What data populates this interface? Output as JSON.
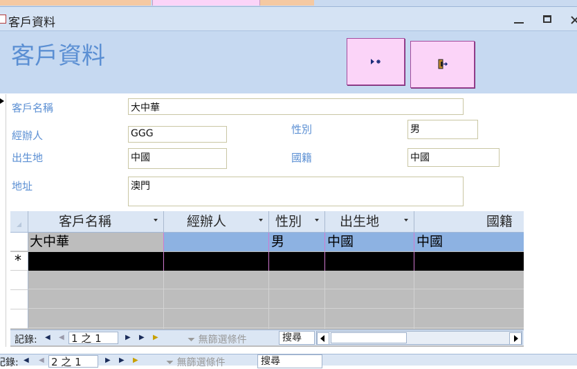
{
  "window": {
    "title": "客戶資料",
    "controls": [
      "minimize-icon",
      "restore-icon",
      "close-icon"
    ]
  },
  "header": {
    "title": "客戶資料",
    "buttons": [
      {
        "name": "new-record-button",
        "icon": "new-record-icon"
      },
      {
        "name": "exit-button",
        "icon": "exit-door-icon"
      }
    ]
  },
  "form": {
    "customer_name_label": "客戶名稱",
    "customer_name_value": "大中華",
    "handler_label": "經辦人",
    "handler_value": "GGG",
    "gender_label": "性別",
    "gender_value": "男",
    "birthplace_label": "出生地",
    "birthplace_value": "中國",
    "nationality_label": "國籍",
    "nationality_value": "中國",
    "address_label": "地址",
    "address_value": "澳門"
  },
  "datasheet": {
    "columns": [
      "客戶名稱",
      "經辦人",
      "性別",
      "出生地",
      "國籍"
    ],
    "rows": [
      [
        "大中華",
        "",
        "男",
        "中國",
        "中國"
      ]
    ],
    "new_row_marker": "*"
  },
  "subform_nav": {
    "record_label": "記錄:",
    "position": "1 之 1",
    "filter": "無篩選條件",
    "search": "搜尋"
  },
  "form_nav": {
    "record_label": "記錄:",
    "position": "2 之 1",
    "filter": "無篩選條件",
    "search": "搜尋"
  },
  "colors": {
    "accent_blue": "#5b8fd3",
    "header_bg": "#c6d9f1",
    "button_pink": "#fbd4f8",
    "selected_row": "#8db2e2"
  }
}
